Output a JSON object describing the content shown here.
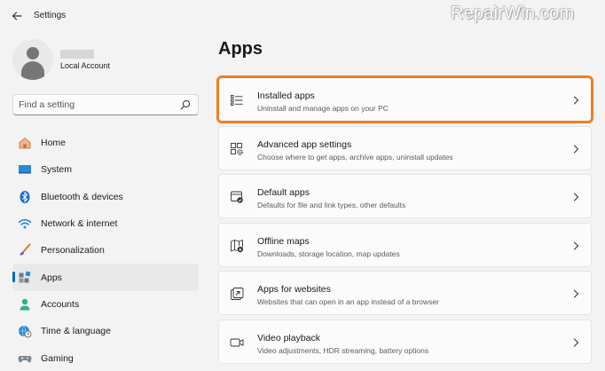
{
  "window": {
    "title": "Settings",
    "watermark": "RepairWin.com"
  },
  "profile": {
    "account_type": "Local Account"
  },
  "search": {
    "placeholder": "Find a setting"
  },
  "sidebar": {
    "items": [
      {
        "label": "Home",
        "icon": "home-icon"
      },
      {
        "label": "System",
        "icon": "monitor-icon"
      },
      {
        "label": "Bluetooth & devices",
        "icon": "bluetooth-icon"
      },
      {
        "label": "Network & internet",
        "icon": "wifi-icon"
      },
      {
        "label": "Personalization",
        "icon": "brush-icon"
      },
      {
        "label": "Apps",
        "icon": "apps-icon",
        "active": true
      },
      {
        "label": "Accounts",
        "icon": "person-icon"
      },
      {
        "label": "Time & language",
        "icon": "globe-clock-icon"
      },
      {
        "label": "Gaming",
        "icon": "gamepad-icon"
      }
    ]
  },
  "main": {
    "title": "Apps",
    "cards": [
      {
        "title": "Installed apps",
        "desc": "Uninstall and manage apps on your PC",
        "icon": "list-icon",
        "highlighted": true
      },
      {
        "title": "Advanced app settings",
        "desc": "Choose where to get apps, archive apps, uninstall updates",
        "icon": "app-settings-icon"
      },
      {
        "title": "Default apps",
        "desc": "Defaults for file and link types, other defaults",
        "icon": "default-apps-icon"
      },
      {
        "title": "Offline maps",
        "desc": "Downloads, storage location, map updates",
        "icon": "map-icon"
      },
      {
        "title": "Apps for websites",
        "desc": "Websites that can open in an app instead of a browser",
        "icon": "open-in-app-icon"
      },
      {
        "title": "Video playback",
        "desc": "Video adjustments, HDR streaming, battery options",
        "icon": "video-icon"
      }
    ]
  },
  "colors": {
    "accent": "#0067c0",
    "highlight": "#f07d24"
  }
}
